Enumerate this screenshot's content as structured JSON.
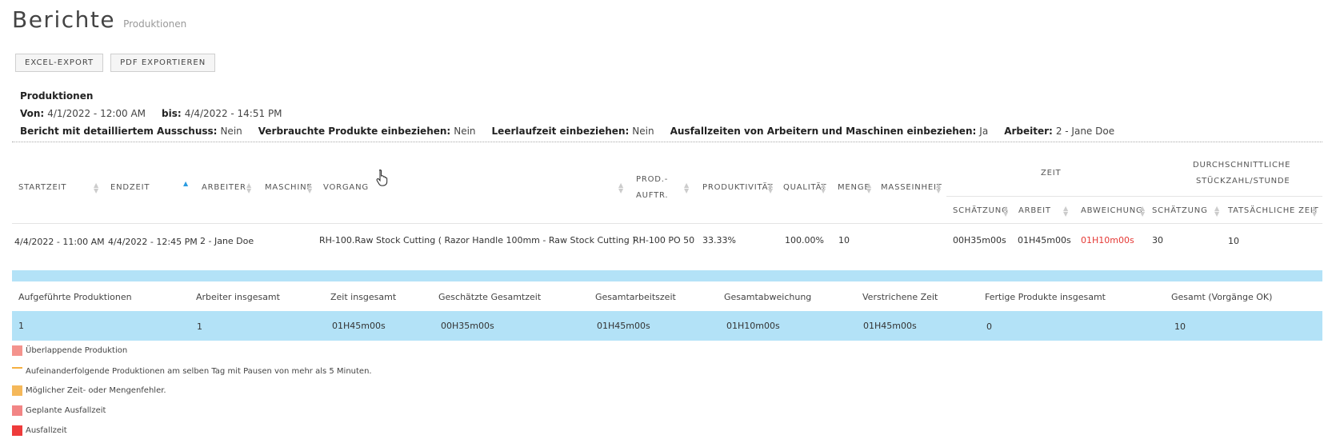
{
  "header": {
    "title": "Berichte",
    "subtitle": "Produktionen"
  },
  "toolbar": {
    "excel_label": "EXCEL-EXPORT",
    "pdf_label": "PDF EXPORTIEREN"
  },
  "params": {
    "section_title": "Produktionen",
    "from_label": "Von:",
    "from_value": "4/1/2022 - 12:00 AM",
    "to_label": "bis:",
    "to_value": "4/4/2022 - 14:51 PM",
    "detailed_scrap_label": "Bericht mit detailliertem Ausschuss:",
    "detailed_scrap_value": "Nein",
    "consumed_label": "Verbrauchte Produkte einbeziehen:",
    "consumed_value": "Nein",
    "idle_label": "Leerlaufzeit einbeziehen:",
    "idle_value": "Nein",
    "downtime_label": "Ausfallzeiten von Arbeitern und Maschinen einbeziehen:",
    "downtime_value": "Ja",
    "worker_label": "Arbeiter:",
    "worker_value": "2 - Jane Doe"
  },
  "table": {
    "columns": {
      "start": "STARTZEIT",
      "end": "ENDZEIT",
      "worker": "ARBEITER",
      "machine": "MASCHINE",
      "operation": "VORGANG",
      "prod_order_1": "PROD.-",
      "prod_order_2": "AUFTR.",
      "productivity": "PRODUKTIVITÄT",
      "quality": "QUALITÄT",
      "quantity": "MENGE",
      "unit": "MASSEINHEIT",
      "time_group": "ZEIT",
      "avg_group_1": "DURCHSCHNITTLICHE",
      "avg_group_2": "STÜCKZAHL/STUNDE",
      "estimate": "SCHÄTZUNG",
      "work": "ARBEIT",
      "deviation": "ABWEICHUNG",
      "avg_estimate": "SCHÄTZUNG",
      "avg_actual": "TATSÄCHLICHE ZEIT"
    },
    "rows": [
      {
        "start": "4/4/2022 - 11:00 AM",
        "end": "4/4/2022 - 12:45 PM",
        "worker": "2 - Jane Doe",
        "machine": "",
        "operation": "RH-100.Raw Stock Cutting ( Razor Handle 100mm - Raw Stock Cutting )",
        "prod_order": "RH-100 PO 50",
        "productivity": "33.33%",
        "quality": "100.00%",
        "quantity": "10",
        "unit": "",
        "estimate": "00H35m00s",
        "work": "01H45m00s",
        "deviation": "01H10m00s",
        "avg_estimate": "30",
        "avg_actual": "10"
      }
    ]
  },
  "summary": {
    "headers": {
      "listed": "Aufgeführte Produktionen",
      "workers": "Arbeiter insgesamt",
      "total_time": "Zeit insgesamt",
      "est_total": "Geschätzte Gesamtzeit",
      "work_total": "Gesamtarbeitszeit",
      "dev_total": "Gesamtabweichung",
      "elapsed": "Verstrichene Zeit",
      "finished": "Fertige Produkte insgesamt",
      "total_ok": "Gesamt (Vorgänge OK)"
    },
    "values": {
      "listed": "1",
      "workers": "1",
      "total_time": "01H45m00s",
      "est_total": "00H35m00s",
      "work_total": "01H45m00s",
      "dev_total": "01H10m00s",
      "elapsed": "01H45m00s",
      "finished": "0",
      "total_ok": "10"
    }
  },
  "legend": [
    {
      "label": "Überlappende Produktion",
      "color": "#f4938d"
    },
    {
      "label": "Aufeinanderfolgende Produktionen am selben Tag mit Pausen von mehr als 5 Minuten.",
      "color": "#f5b041"
    },
    {
      "label": "Möglicher Zeit- oder Mengenfehler.",
      "color": "#f5b85a"
    },
    {
      "label": "Geplante Ausfallzeit",
      "color": "#f28585"
    },
    {
      "label": "Ausfallzeit",
      "color": "#ee3b3b"
    }
  ],
  "colors": {
    "accent": "#2a9be0",
    "band": "#b3e2f7",
    "deviation": "#e53935"
  }
}
